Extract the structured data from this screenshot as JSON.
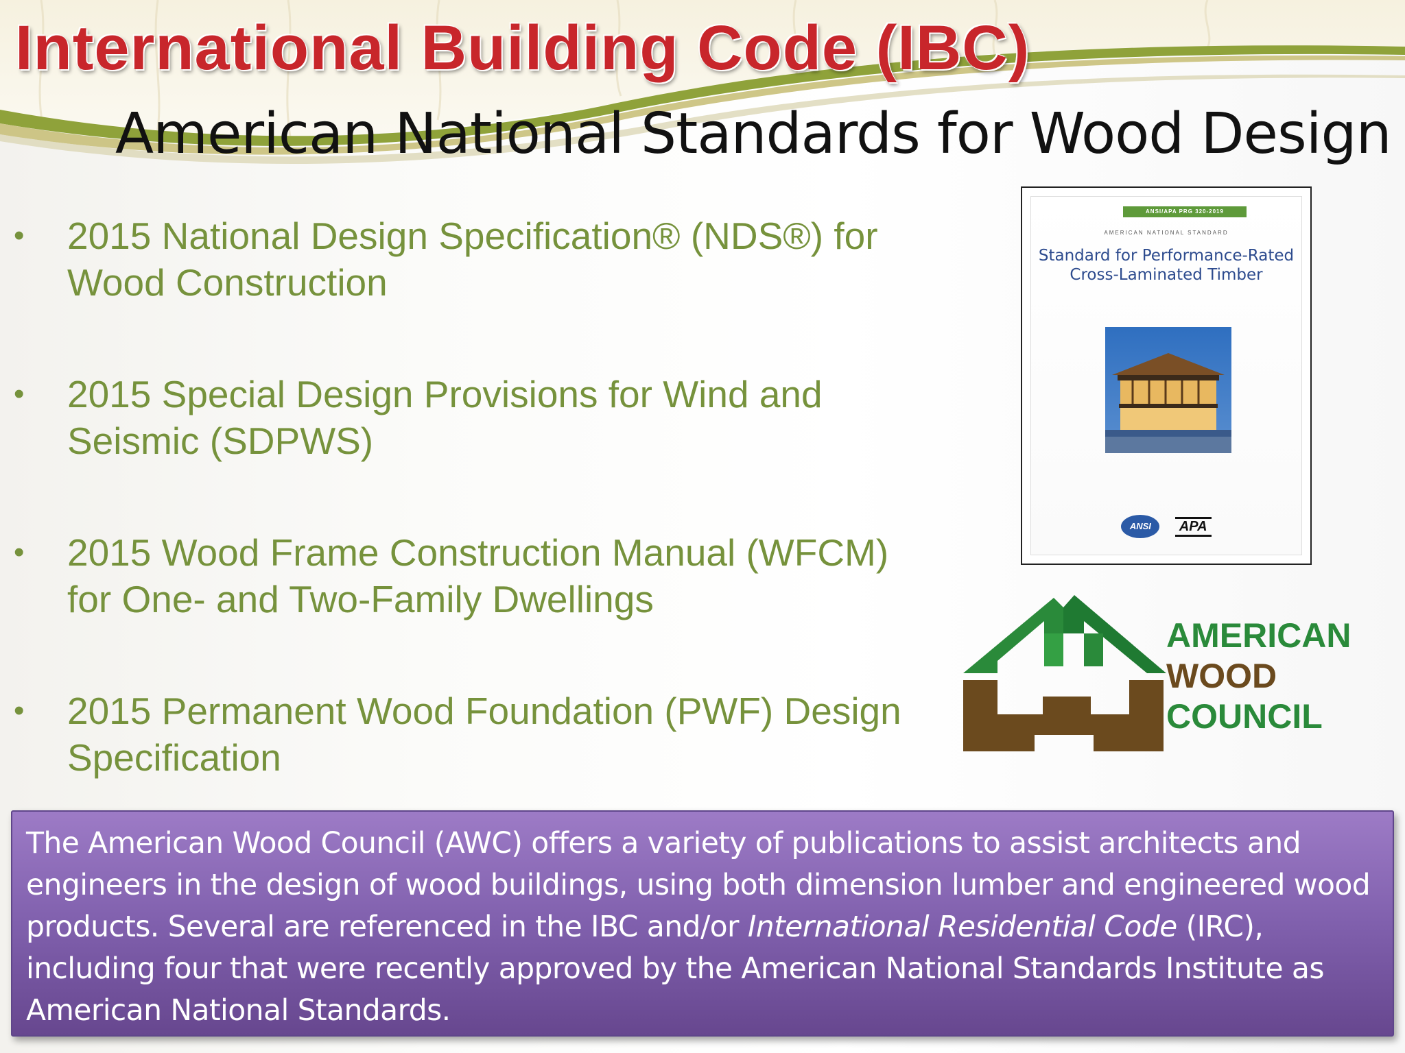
{
  "slide": {
    "title": "International Building Code (IBC)",
    "subtitle": "American National Standards for Wood Design"
  },
  "bullet_symbol": "•",
  "bullets": [
    {
      "line1": "2015 National Design Specification® (NDS®) for",
      "line2": "Wood Construction"
    },
    {
      "line1": "2015 Special Design Provisions for Wind and",
      "line2": "Seismic (SDPWS)"
    },
    {
      "line1": "2015 Wood Frame Construction Manual (WFCM)",
      "line2": "for One- and Two-Family Dwellings"
    },
    {
      "line1": "2015 Permanent Wood Foundation (PWF) Design",
      "line2": "Specification"
    }
  ],
  "book_cover": {
    "band": "ANSI/APA PRG 320-2019",
    "kicker": "AMERICAN NATIONAL STANDARD",
    "title_line1": "Standard for Performance-Rated",
    "title_line2": "Cross-Laminated Timber",
    "logo_ansi": "ANSI",
    "logo_apa": "APA"
  },
  "awc_logo": {
    "line1": "AMERICAN",
    "line2": "WOOD",
    "line3": "COUNCIL"
  },
  "callout": {
    "text_before": "The American Wood Council (AWC) offers a variety of publications to assist architects and engineers in the design of wood buildings, using both dimension lumber and engineered wood products. Several are referenced in the IBC and/or ",
    "text_italic": "International Residential Code",
    "text_after": " (IRC), including four that were recently approved by the American National Standards Institute as American National Standards."
  },
  "colors": {
    "title_red": "#c8262b",
    "bullet_green": "#76923c",
    "callout_purple": "#8060ad",
    "awc_green": "#2a8a3a",
    "awc_brown": "#6b4a1e"
  }
}
